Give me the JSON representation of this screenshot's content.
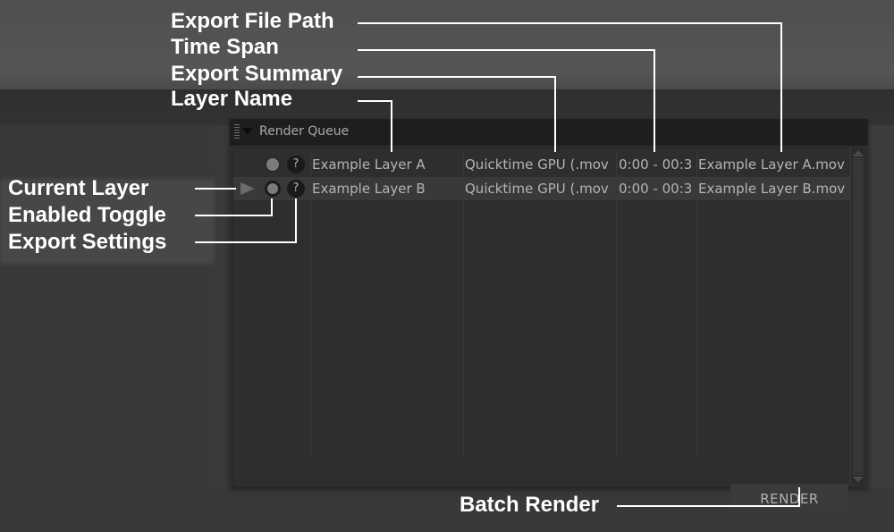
{
  "panel": {
    "title": "Render Queue",
    "rows": [
      {
        "current": false,
        "enabled": true,
        "settings_glyph": "?",
        "layer_name": "Example Layer A",
        "export_summary": "Quicktime GPU (.mov",
        "time_span": "0:00 - 00:3",
        "file_path": "Example Layer A.mov"
      },
      {
        "current": true,
        "enabled": true,
        "settings_glyph": "?",
        "layer_name": "Example Layer B",
        "export_summary": "Quicktime GPU (.mov",
        "time_span": "0:00 - 00:3",
        "file_path": "Example Layer B.mov"
      }
    ],
    "render_button": "RENDER"
  },
  "annotations": {
    "export_file_path": "Export File Path",
    "time_span": "Time Span",
    "export_summary": "Export Summary",
    "layer_name": "Layer Name",
    "current_layer": "Current Layer",
    "enabled_toggle": "Enabled Toggle",
    "export_settings": "Export Settings",
    "batch_render": "Batch Render"
  },
  "icons": {
    "grip": "grip-icon",
    "collapse": "triangle-down",
    "current_layer": "play-triangle",
    "enabled": "circle-toggle",
    "settings": "question-mark",
    "scroll_up": "triangle-up",
    "scroll_down": "triangle-down"
  },
  "colors": {
    "panel_bg": "#2f2f2f",
    "header_bg": "#1d1f1f",
    "text": "#b4b4b4",
    "annotation": "#ffffff"
  }
}
